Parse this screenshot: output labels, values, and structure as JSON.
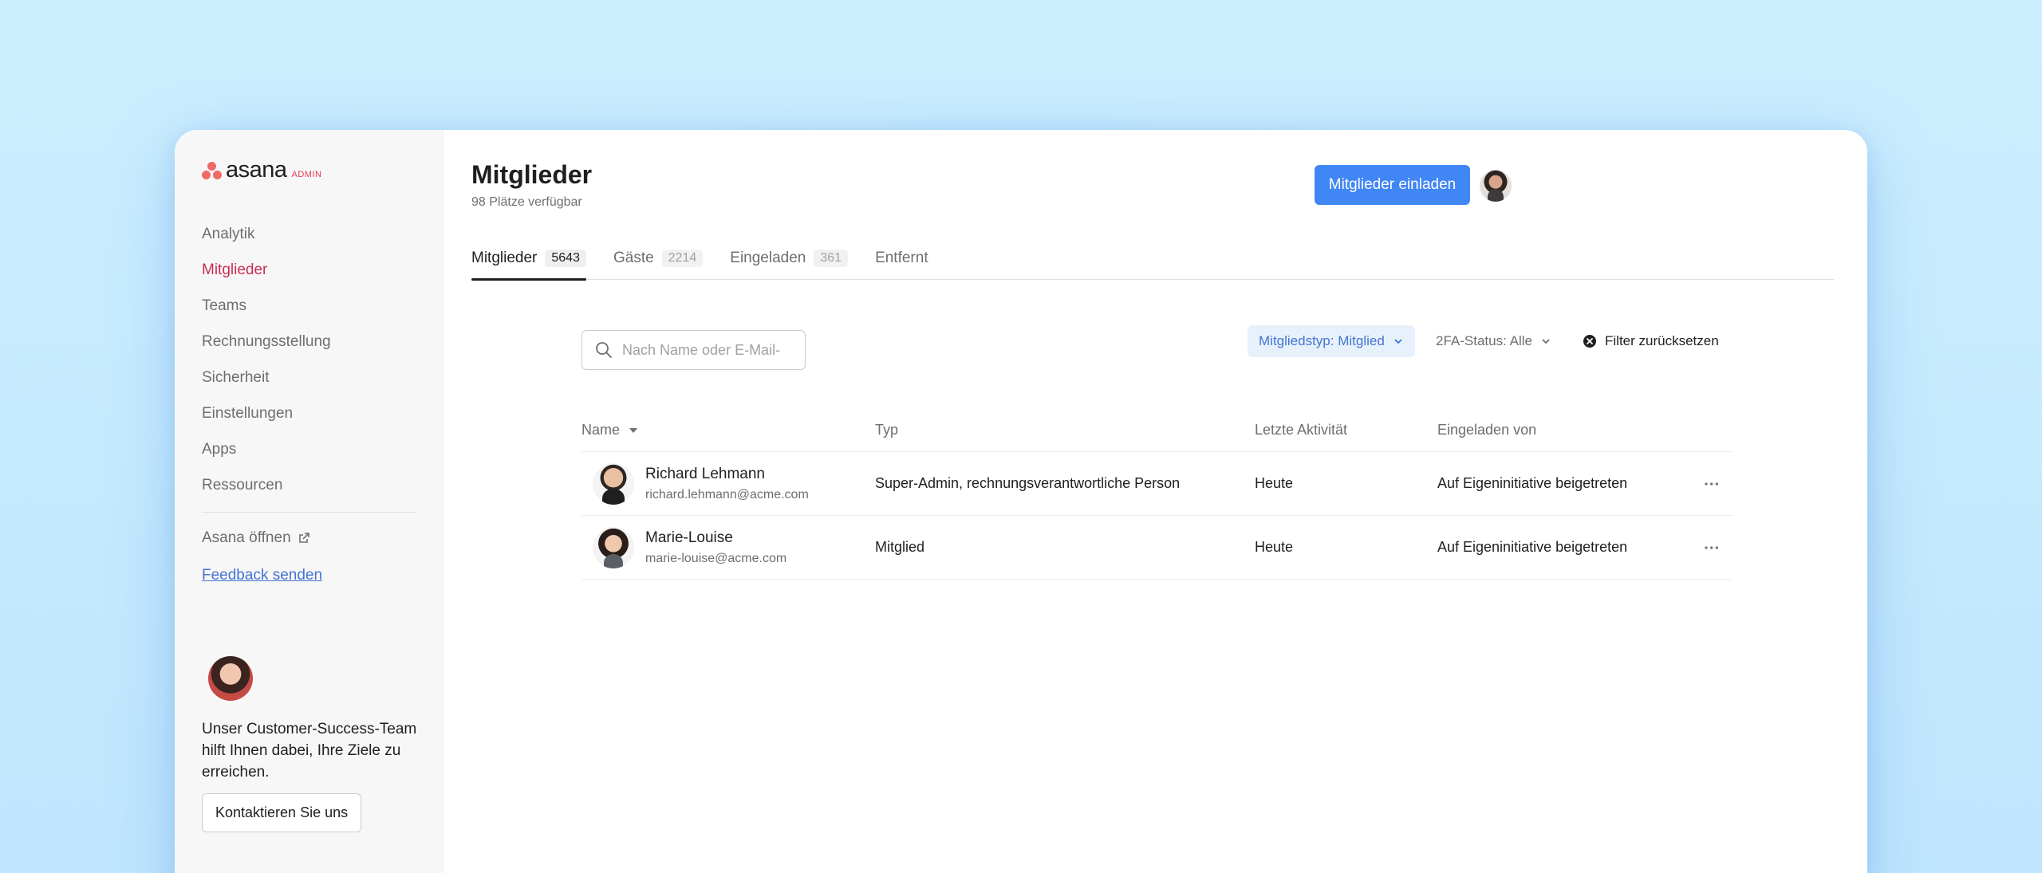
{
  "brand": {
    "wordmark": "asana",
    "tag": "ADMIN",
    "accent": "#f06a6a"
  },
  "sidebar": {
    "items": [
      {
        "label": "Analytik",
        "active": false
      },
      {
        "label": "Mitglieder",
        "active": true
      },
      {
        "label": "Teams",
        "active": false
      },
      {
        "label": "Rechnungsstellung",
        "active": false
      },
      {
        "label": "Sicherheit",
        "active": false
      },
      {
        "label": "Einstellungen",
        "active": false
      },
      {
        "label": "Apps",
        "active": false
      },
      {
        "label": "Ressourcen",
        "active": false
      }
    ],
    "open_asana": "Asana öffnen",
    "feedback": "Feedback senden",
    "cs_text": "Unser Customer-Success-Team hilft Ihnen dabei, Ihre Ziele zu erreichen.",
    "contact_button": "Kontaktieren Sie uns"
  },
  "header": {
    "title": "Mitglieder",
    "subtitle": "98 Plätze verfügbar",
    "invite_button": "Mitglieder einladen"
  },
  "tabs": [
    {
      "label": "Mitglieder",
      "count": "5643",
      "active": true
    },
    {
      "label": "Gäste",
      "count": "2214",
      "active": false
    },
    {
      "label": "Eingeladen",
      "count": "361",
      "active": false
    },
    {
      "label": "Entfernt",
      "count": "",
      "active": false
    }
  ],
  "search": {
    "placeholder": "Nach Name oder E-Mail-",
    "value": ""
  },
  "filters": {
    "type": "Mitgliedstyp: Mitglied",
    "twofa": "2FA-Status: Alle",
    "reset": "Filter zurücksetzen"
  },
  "table": {
    "columns": [
      "Name",
      "Typ",
      "Letzte Aktivität",
      "Eingeladen von"
    ],
    "rows": [
      {
        "name": "Richard Lehmann",
        "email": "richard.lehmann@acme.com",
        "type": "Super-Admin, rechnungsverantwortliche Person",
        "activity": "Heute",
        "invited_by": "Auf Eigeninitiative beigetreten"
      },
      {
        "name": "Marie-Louise",
        "email": "marie-louise@acme.com",
        "type": "Mitglied",
        "activity": "Heute",
        "invited_by": "Auf Eigeninitiative beigetreten"
      }
    ]
  },
  "colors": {
    "active_nav": "#c92f54",
    "primary_button": "#4186f5",
    "filter_active_bg": "#e6f1fb"
  }
}
